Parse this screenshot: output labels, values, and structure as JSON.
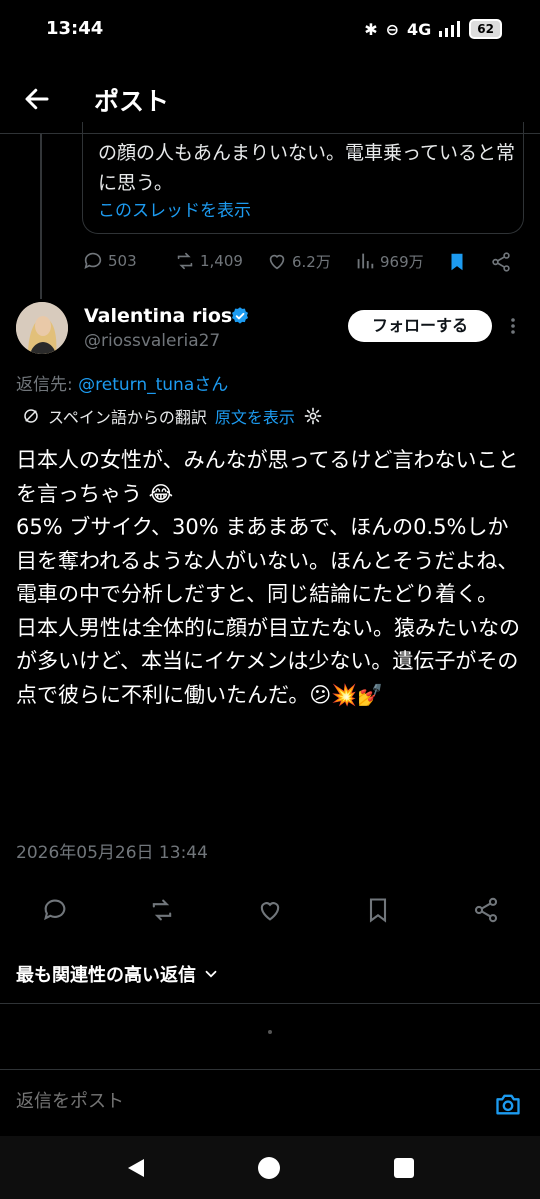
{
  "status_bar": {
    "time": "13:44",
    "network": "4G",
    "battery": "62"
  },
  "header": {
    "title": "ポスト"
  },
  "quoted_post": {
    "text": "の顔の人もあんまりいない。電車乗っていると常に思う。",
    "thread_link": "このスレッドを表示"
  },
  "prev_actions": {
    "replies": "503",
    "reposts": "1,409",
    "likes": "6.2万",
    "views": "969万"
  },
  "author": {
    "name": "Valentina rios",
    "handle": "@riossvaleria27",
    "follow_label": "フォローする"
  },
  "reply_to": {
    "prefix": "返信先: ",
    "user": "@return_tunaさん"
  },
  "translation": {
    "label": "スペイン語からの翻訳",
    "show_original": "原文を表示"
  },
  "post": {
    "body": "日本人の女性が、みんなが思ってるけど言わないことを言っちゃう 😂\n65% ブサイク、30% まあまあで、ほんの0.5%しか目を奪われるような人がいない。ほんとそうだよね、電車の中で分析しだすと、同じ結論にたどり着く。\n日本人男性は全体的に顔が目立たない。猿みたいなのが多いけど、本当にイケメンは少ない。遺伝子がその点で彼らに不利に働いたんだ。😕💥💅",
    "timestamp": "2026年05月26日 13:44"
  },
  "replies_sort": {
    "label": "最も関連性の高い返信"
  },
  "composer": {
    "placeholder": "返信をポスト"
  },
  "colors": {
    "accent": "#1d9bf0",
    "muted": "#71767b",
    "background": "#000000"
  }
}
